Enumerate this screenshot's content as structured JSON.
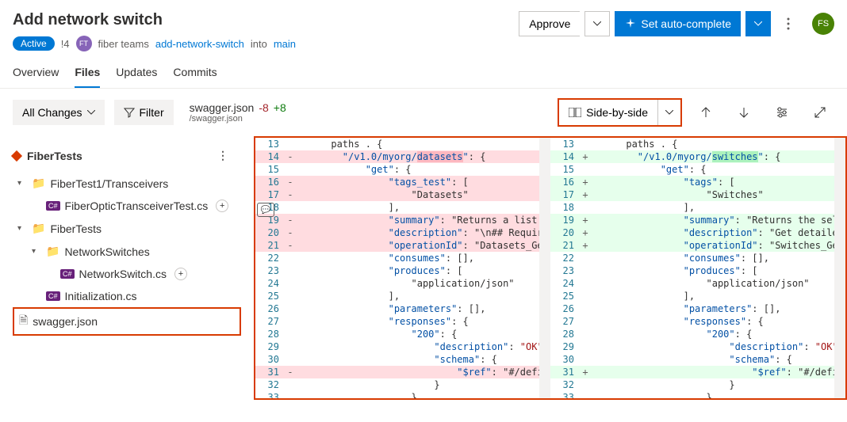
{
  "header": {
    "title": "Add network switch",
    "status_badge": "Active",
    "pr_id": "!4",
    "team_initials": "FT",
    "team_name": "fiber teams",
    "source_branch": "add-network-switch",
    "into_label": "into",
    "target_branch": "main"
  },
  "actions": {
    "approve": "Approve",
    "auto_complete": "Set auto-complete",
    "user_initials": "FS"
  },
  "tabs": [
    "Overview",
    "Files",
    "Updates",
    "Commits"
  ],
  "active_tab": "Files",
  "toolbar": {
    "all_changes": "All Changes",
    "filter": "Filter",
    "file_name": "swagger.json",
    "deletions": "-8",
    "additions": "+8",
    "file_path": "/swagger.json",
    "view_mode": "Side-by-side"
  },
  "sidebar": {
    "project": "FiberTests",
    "tree": [
      {
        "type": "folder",
        "label": "FiberTest1/Transceivers",
        "depth": 0,
        "expanded": true
      },
      {
        "type": "cs",
        "label": "FiberOpticTransceiverTest.cs",
        "depth": 1,
        "plus": true
      },
      {
        "type": "folder",
        "label": "FiberTests",
        "depth": 0,
        "expanded": true
      },
      {
        "type": "folder",
        "label": "NetworkSwitches",
        "depth": 1,
        "expanded": true
      },
      {
        "type": "cs",
        "label": "NetworkSwitch.cs",
        "depth": 2,
        "plus": true
      },
      {
        "type": "cs",
        "label": "Initialization.cs",
        "depth": 1
      },
      {
        "type": "file",
        "label": "swagger.json",
        "depth": 1,
        "selected": true
      }
    ]
  },
  "diff": {
    "left": [
      {
        "n": 13,
        "m": "",
        "cls": "",
        "code": "      paths . {"
      },
      {
        "n": 14,
        "m": "-",
        "cls": "del",
        "code": "        \"/v1.0/myorg/datasets\": {",
        "hl": "datasets"
      },
      {
        "n": 15,
        "m": "",
        "cls": "",
        "code": "            \"get\": {"
      },
      {
        "n": 16,
        "m": "-",
        "cls": "del",
        "code": "                \"tags_test\": ["
      },
      {
        "n": 17,
        "m": "-",
        "cls": "del",
        "code": "                    \"Datasets\""
      },
      {
        "n": 18,
        "m": "",
        "cls": "",
        "code": "                ],"
      },
      {
        "n": 19,
        "m": "-",
        "cls": "del",
        "code": "                \"summary\": \"Returns a list of"
      },
      {
        "n": 20,
        "m": "-",
        "cls": "del",
        "code": "                \"description\": \"\\n## Required"
      },
      {
        "n": 21,
        "m": "-",
        "cls": "del",
        "code": "                \"operationId\": \"Datasets_GetD"
      },
      {
        "n": 22,
        "m": "",
        "cls": "",
        "code": "                \"consumes\": [],"
      },
      {
        "n": 23,
        "m": "",
        "cls": "",
        "code": "                \"produces\": ["
      },
      {
        "n": 24,
        "m": "",
        "cls": "",
        "code": "                    \"application/json\""
      },
      {
        "n": 25,
        "m": "",
        "cls": "",
        "code": "                ],"
      },
      {
        "n": 26,
        "m": "",
        "cls": "",
        "code": "                \"parameters\": [],"
      },
      {
        "n": 27,
        "m": "",
        "cls": "",
        "code": "                \"responses\": {"
      },
      {
        "n": 28,
        "m": "",
        "cls": "",
        "code": "                    \"200\": {"
      },
      {
        "n": 29,
        "m": "",
        "cls": "",
        "code": "                        \"description\": \"OK\","
      },
      {
        "n": 30,
        "m": "",
        "cls": "",
        "code": "                        \"schema\": {"
      },
      {
        "n": 31,
        "m": "-",
        "cls": "del",
        "code": "                            \"$ref\": \"#/definit"
      },
      {
        "n": 32,
        "m": "",
        "cls": "",
        "code": "                        }"
      },
      {
        "n": 33,
        "m": "",
        "cls": "",
        "code": "                    }"
      }
    ],
    "right": [
      {
        "n": 13,
        "m": "",
        "cls": "",
        "code": "      paths . {"
      },
      {
        "n": 14,
        "m": "+",
        "cls": "add",
        "code": "        \"/v1.0/myorg/switches\": {",
        "hl": "switches"
      },
      {
        "n": 15,
        "m": "",
        "cls": "",
        "code": "            \"get\": {"
      },
      {
        "n": 16,
        "m": "+",
        "cls": "add",
        "code": "                \"tags\": ["
      },
      {
        "n": 17,
        "m": "+",
        "cls": "add",
        "code": "                    \"Switches\""
      },
      {
        "n": 18,
        "m": "",
        "cls": "",
        "code": "                ],"
      },
      {
        "n": 19,
        "m": "+",
        "cls": "add",
        "code": "                \"summary\": \"Returns the select"
      },
      {
        "n": 20,
        "m": "+",
        "cls": "add",
        "code": "                \"description\": \"Get detailed s"
      },
      {
        "n": 21,
        "m": "+",
        "cls": "add",
        "code": "                \"operationId\": \"Switches_GetSw"
      },
      {
        "n": 22,
        "m": "",
        "cls": "",
        "code": "                \"consumes\": [],"
      },
      {
        "n": 23,
        "m": "",
        "cls": "",
        "code": "                \"produces\": ["
      },
      {
        "n": 24,
        "m": "",
        "cls": "",
        "code": "                    \"application/json\""
      },
      {
        "n": 25,
        "m": "",
        "cls": "",
        "code": "                ],"
      },
      {
        "n": 26,
        "m": "",
        "cls": "",
        "code": "                \"parameters\": [],"
      },
      {
        "n": 27,
        "m": "",
        "cls": "",
        "code": "                \"responses\": {"
      },
      {
        "n": 28,
        "m": "",
        "cls": "",
        "code": "                    \"200\": {"
      },
      {
        "n": 29,
        "m": "",
        "cls": "",
        "code": "                        \"description\": \"OK\","
      },
      {
        "n": 30,
        "m": "",
        "cls": "",
        "code": "                        \"schema\": {"
      },
      {
        "n": 31,
        "m": "+",
        "cls": "add",
        "code": "                            \"$ref\": \"#/definit"
      },
      {
        "n": 32,
        "m": "",
        "cls": "",
        "code": "                        }"
      },
      {
        "n": 33,
        "m": "",
        "cls": "",
        "code": "                    }"
      }
    ]
  }
}
